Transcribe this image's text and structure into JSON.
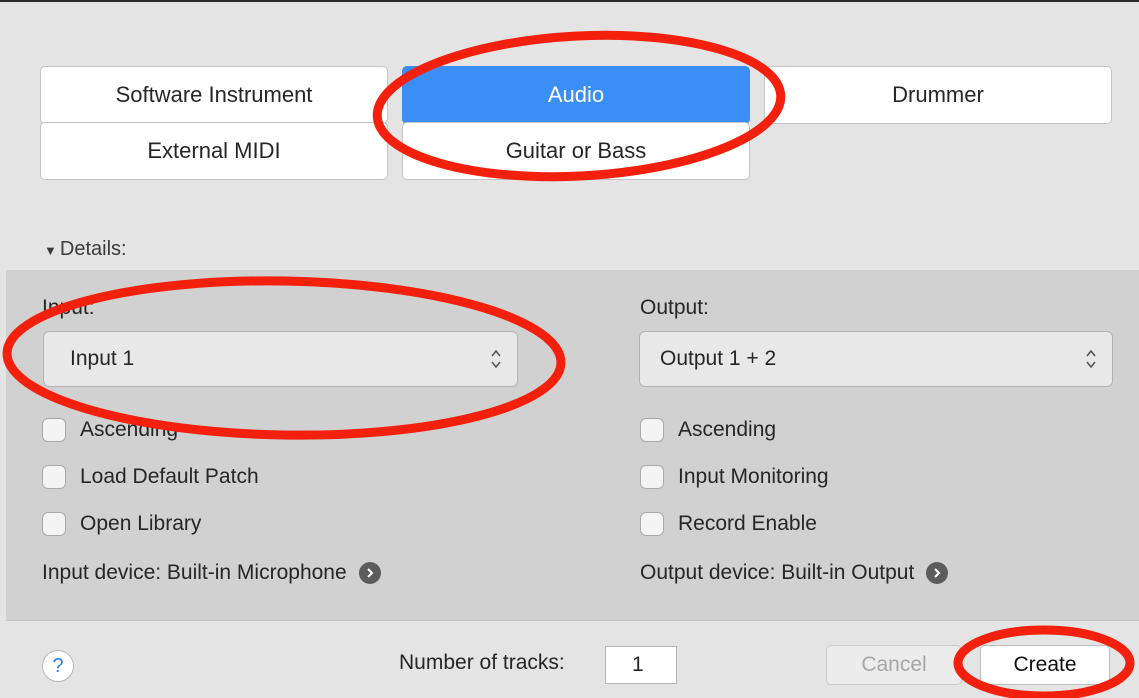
{
  "track_types": {
    "software_instrument": "Software Instrument",
    "audio": "Audio",
    "drummer": "Drummer",
    "external_midi": "External MIDI",
    "guitar_or_bass": "Guitar or Bass",
    "selected": "Audio"
  },
  "details": {
    "toggle_label": "Details:",
    "input": {
      "label": "Input:",
      "value": "Input 1",
      "checkboxes": [
        {
          "label": "Ascending",
          "checked": false
        },
        {
          "label": "Load Default Patch",
          "checked": false
        },
        {
          "label": "Open Library",
          "checked": false
        }
      ],
      "device_label": "Input device: Built-in Microphone"
    },
    "output": {
      "label": "Output:",
      "value": "Output 1 + 2",
      "checkboxes": [
        {
          "label": "Ascending",
          "checked": false
        },
        {
          "label": "Input Monitoring",
          "checked": false
        },
        {
          "label": "Record Enable",
          "checked": false
        }
      ],
      "device_label": "Output device: Built-in Output"
    }
  },
  "footer": {
    "help_label": "?",
    "tracks_label": "Number of tracks:",
    "tracks_value": "1",
    "cancel_label": "Cancel",
    "create_label": "Create"
  },
  "colors": {
    "accent": "#3a8ef5",
    "annotation": "#f2200c"
  },
  "icons": [
    "chevron-updown-icon",
    "arrow-right-circle-icon",
    "disclosure-triangle-icon",
    "help-icon"
  ]
}
